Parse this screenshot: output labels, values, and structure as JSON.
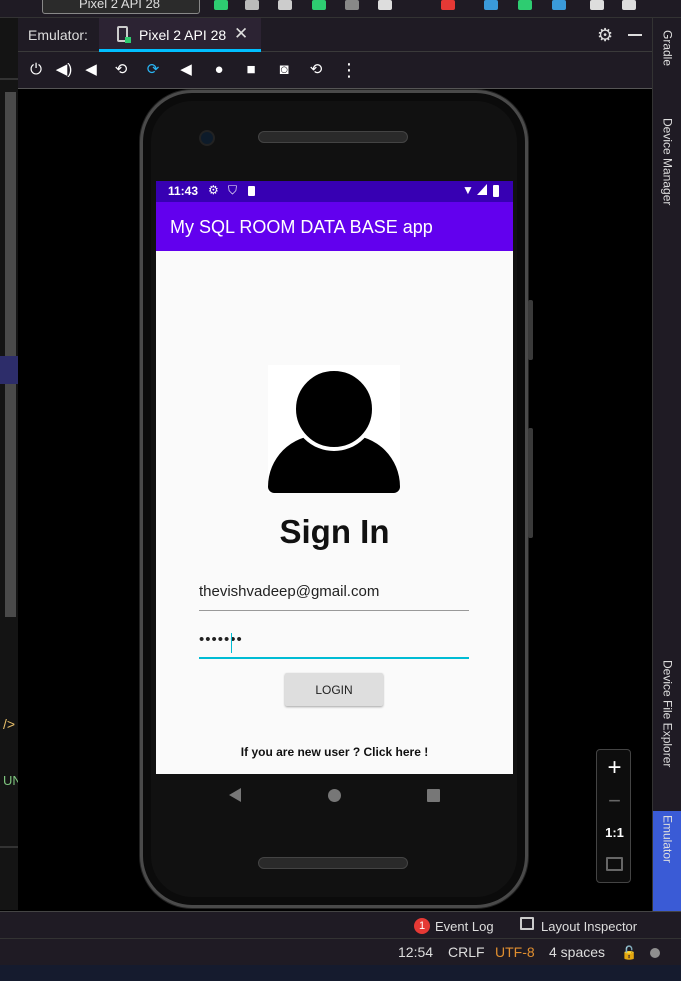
{
  "ide": {
    "device_selector": "Pixel 2 API 28"
  },
  "emulator_window": {
    "title": "Emulator:",
    "tab_label": "Pixel 2 API 28",
    "tab_close": "✕",
    "settings_icon": "gear-icon",
    "minimize_icon": "minimize-icon"
  },
  "emulator_controls": [
    {
      "name": "power-icon",
      "glyph": "⏻"
    },
    {
      "name": "volume-up-icon",
      "glyph": "🔊"
    },
    {
      "name": "volume-down-icon",
      "glyph": "🔉"
    },
    {
      "name": "rotate-left-icon",
      "glyph": "⟲"
    },
    {
      "name": "rotate-right-icon",
      "glyph": "⟳"
    },
    {
      "name": "back-icon",
      "glyph": "◀"
    },
    {
      "name": "home-icon",
      "glyph": "●"
    },
    {
      "name": "overview-icon",
      "glyph": "■"
    },
    {
      "name": "camera-icon",
      "glyph": "📷"
    },
    {
      "name": "snapshot-icon",
      "glyph": "⟲"
    },
    {
      "name": "more-icon",
      "glyph": "⋮"
    }
  ],
  "side_tabs": {
    "gradle": "Gradle",
    "device_manager": "Device Manager",
    "device_file_explorer": "Device File Explorer",
    "emulator": "Emulator"
  },
  "phone": {
    "status_bar": {
      "time": "11:43"
    },
    "app_bar_title": "My SQL ROOM DATA BASE app",
    "sign_in_title": "Sign In",
    "email_value": "thevishvadeep@gmail.com",
    "password_value": "•••••••",
    "login_button": "LOGIN",
    "new_user_link": "If you are new user ? Click here !"
  },
  "zoom": {
    "zoom_in": "+",
    "zoom_out": "−",
    "ratio": "1:1"
  },
  "tool_windows": {
    "event_log_count": "1",
    "event_log": "Event Log",
    "layout_inspector": "Layout Inspector"
  },
  "status_bar": {
    "caret_position": "12:54",
    "line_separator": "CRLF",
    "encoding": "UTF-8",
    "indent": "4 spaces"
  },
  "colors": {
    "app_bar": "#6200ee",
    "status_bar": "#3700b3",
    "accent": "#00bcd4",
    "tab_underline": "#00bfff",
    "encoding_warning": "#e08e2f"
  }
}
